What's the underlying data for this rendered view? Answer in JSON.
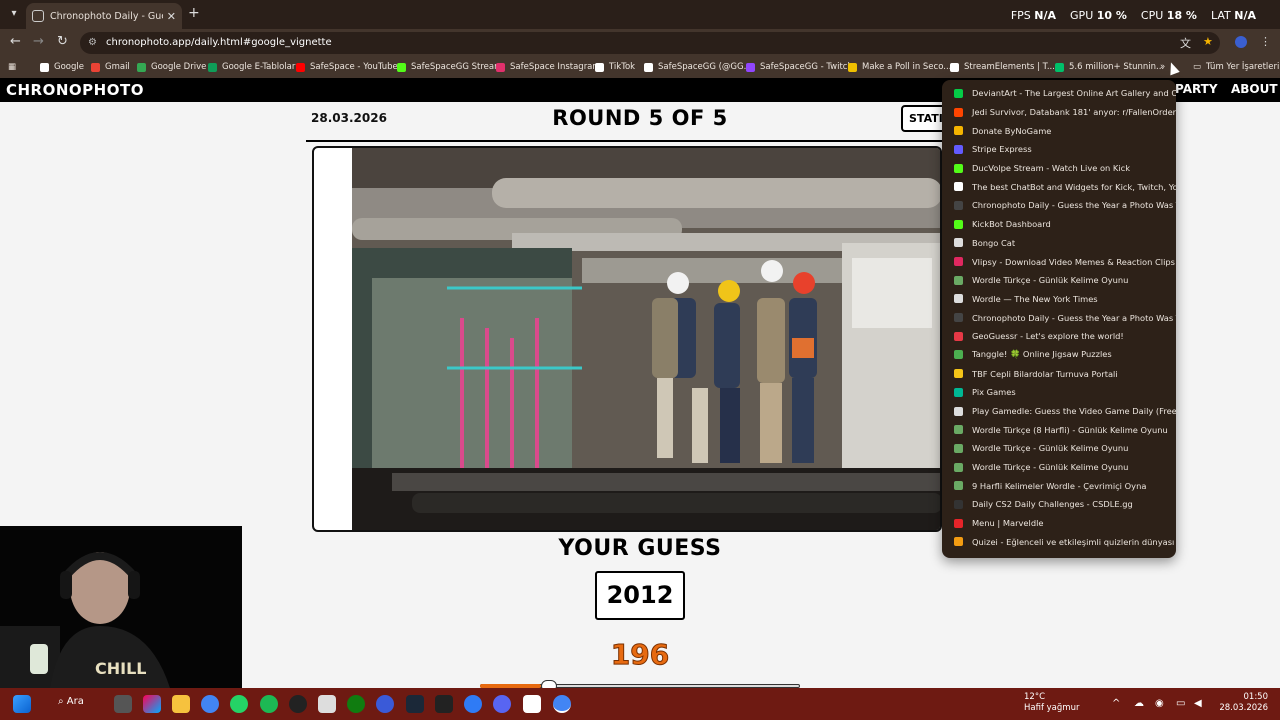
{
  "browser": {
    "tab_title": "Chronophoto Daily - Guess the Year",
    "url": "chronophoto.app/daily.html#google_vignette",
    "perf": {
      "fps_label": "FPS",
      "fps_value": "N/A",
      "gpu_label": "GPU",
      "gpu_value": "10 %",
      "cpu_label": "CPU",
      "cpu_value": "18 %",
      "lat_label": "LAT",
      "lat_value": "N/A"
    },
    "bookmarks": [
      {
        "label": "Google",
        "color": "#ffffff"
      },
      {
        "label": "Gmail",
        "color": "#ea4335"
      },
      {
        "label": "Google Drive",
        "color": "#34a853"
      },
      {
        "label": "Google E-Tablolar",
        "color": "#0f9d58"
      },
      {
        "label": "SafeSpace - YouTube",
        "color": "#ff0000"
      },
      {
        "label": "SafeSpaceGG Stream",
        "color": "#53fc18"
      },
      {
        "label": "SafeSpace Instagram",
        "color": "#e1306c"
      },
      {
        "label": "TikTok",
        "color": "#ffffff"
      },
      {
        "label": "SafeSpaceGG (@GG...",
        "color": "#ffffff"
      },
      {
        "label": "SafeSpaceGG - Twitch",
        "color": "#9146ff"
      },
      {
        "label": "Make a Poll in Seco...",
        "color": "#f0c000"
      },
      {
        "label": "StreamElements | T...",
        "color": "#ffffff"
      },
      {
        "label": "5.6 million+ Stunnin...",
        "color": "#00c06a"
      }
    ],
    "all_bookmarks_label": "Tüm Yer İşaretleri",
    "overflow_items": [
      {
        "label": "DeviantArt - The Largest Online Art Gallery and Co...",
        "color": "#05cc47"
      },
      {
        "label": "Jedi Survivor, Databank 181' anyor: r/FallenOrder",
        "color": "#ff4500"
      },
      {
        "label": "Donate ByNoGame",
        "color": "#f5b400"
      },
      {
        "label": "Stripe Express",
        "color": "#635bff"
      },
      {
        "label": "DucVolpe Stream - Watch Live on Kick",
        "color": "#53fc18"
      },
      {
        "label": "The best ChatBot and Widgets for Kick, Twitch, YouT...",
        "color": "#ffffff"
      },
      {
        "label": "Chronophoto Daily - Guess the Year a Photo Was Ta...",
        "color": "#444444"
      },
      {
        "label": "KickBot Dashboard",
        "color": "#53fc18"
      },
      {
        "label": "Bongo Cat",
        "color": "#dddddd"
      },
      {
        "label": "Vlipsy - Download Video Memes & Reaction Clips f...",
        "color": "#e02860"
      },
      {
        "label": "Wordle Türkçe - Günlük Kelime Oyunu",
        "color": "#6aaa64"
      },
      {
        "label": "Wordle — The New York Times",
        "color": "#dddddd"
      },
      {
        "label": "Chronophoto Daily - Guess the Year a Photo Was Ta...",
        "color": "#444444"
      },
      {
        "label": "GeoGuessr - Let's explore the world!",
        "color": "#e63946"
      },
      {
        "label": "Tanggle! 🍀 Online Jigsaw Puzzles",
        "color": "#4caf50"
      },
      {
        "label": "TBF Cepli Bilardolar Turnuva Portali",
        "color": "#f5c518"
      },
      {
        "label": "Pix Games",
        "color": "#00b894"
      },
      {
        "label": "Play Gamedle: Guess the Video Game Daily (Free)",
        "color": "#dddddd"
      },
      {
        "label": "Wordle Türkçe (8 Harfli) - Günlük Kelime Oyunu",
        "color": "#6aaa64"
      },
      {
        "label": "Wordle Türkçe - Günlük Kelime Oyunu",
        "color": "#6aaa64"
      },
      {
        "label": "Wordle Türkçe - Günlük Kelime Oyunu",
        "color": "#6aaa64"
      },
      {
        "label": "9 Harfli Kelimeler Wordle - Çevrimiçi Oyna",
        "color": "#6aaa64"
      },
      {
        "label": "Daily CS2 Daily Challenges - CSDLE.gg",
        "color": "#333333"
      },
      {
        "label": "Menu | Marveldle",
        "color": "#e62429"
      },
      {
        "label": "Quizei - Eğlenceli ve etkileşimli quizlerin dünyası",
        "color": "#f39c12"
      }
    ]
  },
  "page": {
    "logo": "CHRONOPHOTO",
    "nav_party": "PARTY",
    "nav_about": "ABOUT",
    "date": "28.03.2026",
    "round_title": "ROUND 5 OF 5",
    "stats_label": "STATISTICS",
    "your_guess_label": "YOUR GUESS",
    "guess_year": "2012",
    "score": "196",
    "slider_level": 0.19,
    "accent": "#e76a10"
  },
  "taskbar": {
    "search_label": "Ara",
    "weather_temp": "12°C",
    "weather_desc": "Hafif yağmur",
    "time": "01:50",
    "date": "28.03.2026"
  }
}
